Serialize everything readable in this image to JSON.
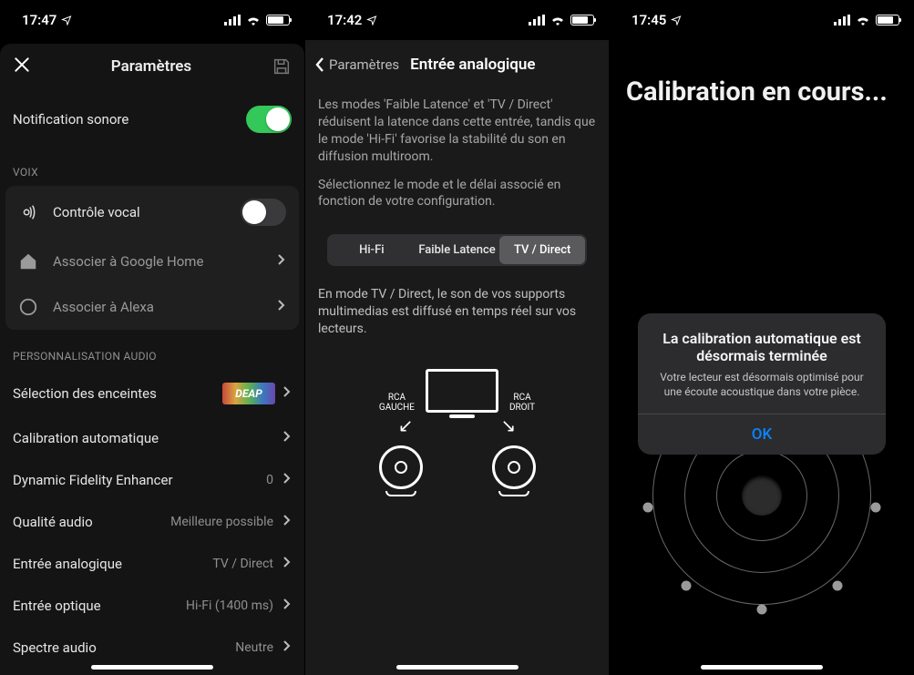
{
  "panel1": {
    "status_time": "17:47",
    "nav_title": "Paramètres",
    "notification_sound": {
      "label": "Notification sonore",
      "value": true
    },
    "voix_header": "VOIX",
    "voice_control": {
      "label": "Contrôle vocal",
      "value": false
    },
    "assoc_google": "Associer à Google Home",
    "assoc_alexa": "Associer à Alexa",
    "personnalisation_header": "PERSONNALISATION AUDIO",
    "selection_enceintes": "Sélection des enceintes",
    "deap_badge": "DEAP",
    "calibration_auto": "Calibration automatique",
    "dfe": {
      "label": "Dynamic Fidelity Enhancer",
      "value": "0"
    },
    "quality": {
      "label": "Qualité audio",
      "value": "Meilleure possible"
    },
    "analog_in": {
      "label": "Entrée analogique",
      "value": "TV / Direct"
    },
    "optical_in": {
      "label": "Entrée optique",
      "value": "Hi-Fi (1400 ms)"
    },
    "spectrum": {
      "label": "Spectre audio",
      "value": "Neutre"
    }
  },
  "panel2": {
    "status_time": "17:42",
    "back_label": "Paramètres",
    "title": "Entrée analogique",
    "info1": "Les modes 'Faible Latence' et 'TV / Direct' réduisent la latence dans cette entrée, tandis que le mode 'Hi-Fi' favorise la stabilité du son en diffusion multiroom.",
    "info2": "Sélectionnez le mode et le délai associé en fonction de votre configuration.",
    "segments": [
      "Hi-Fi",
      "Faible Latence",
      "TV / Direct"
    ],
    "selected_index": 2,
    "mode_desc": "En mode TV / Direct, le son de vos supports multimedias est diffusé en temps réel sur vos lecteurs.",
    "rca_left": "RCA\nGAUCHE",
    "rca_right": "RCA\nDROIT"
  },
  "panel3": {
    "status_time": "17:45",
    "title": "Calibration en cours...",
    "alert_title": "La calibration automatique est désormais terminée",
    "alert_message": "Votre lecteur est désormais optimisé pour une écoute acoustique dans votre pièce.",
    "alert_button": "OK"
  }
}
